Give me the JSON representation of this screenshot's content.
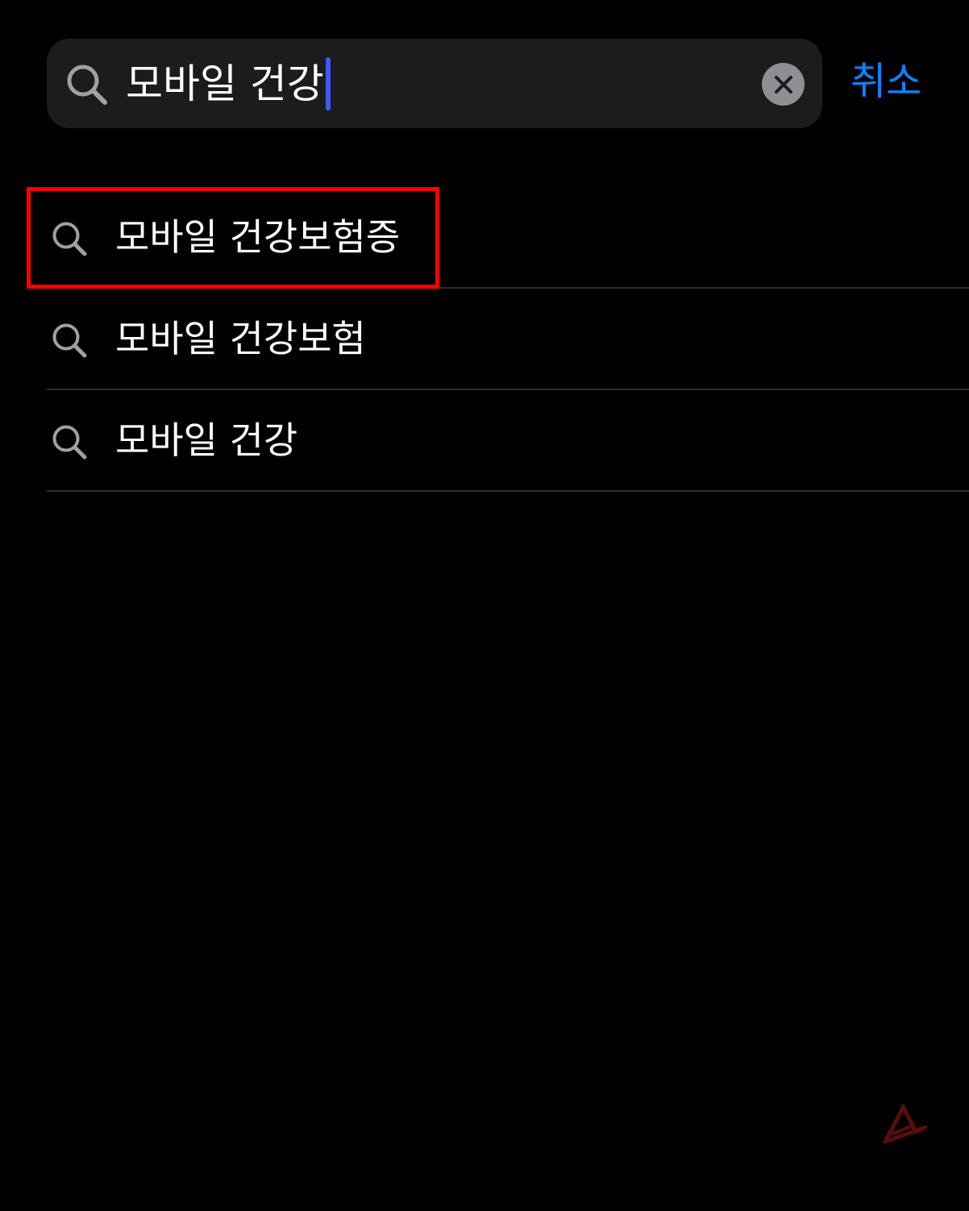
{
  "search": {
    "query": "모바일 건강",
    "icon": "search-icon",
    "clear_icon": "close-icon"
  },
  "cancel_label": "취소",
  "suggestions": [
    {
      "label": "모바일 건강보험증",
      "icon": "search-icon",
      "highlighted": true
    },
    {
      "label": "모바일 건강보험",
      "icon": "search-icon",
      "highlighted": false
    },
    {
      "label": "모바일 건강",
      "icon": "search-icon",
      "highlighted": false
    }
  ],
  "colors": {
    "background": "#000000",
    "search_field": "#1c1c1e",
    "accent": "#0a84ff",
    "caret": "#3b5bff",
    "highlight": "#ff0000",
    "separator": "#2c2c2e",
    "icon_gray": "#8e8e93"
  }
}
